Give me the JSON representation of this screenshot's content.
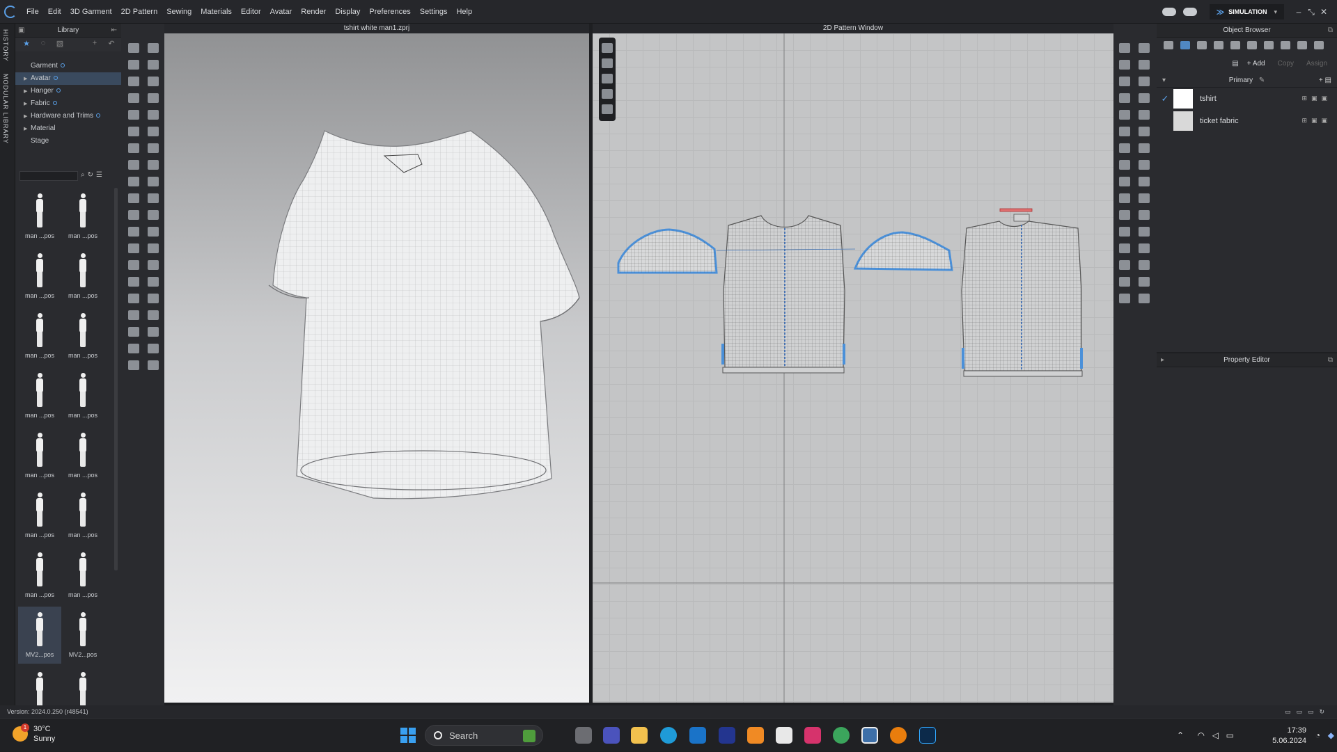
{
  "menubar": {
    "items": [
      "File",
      "Edit",
      "3D Garment",
      "2D Pattern",
      "Sewing",
      "Materials",
      "Editor",
      "Avatar",
      "Render",
      "Display",
      "Preferences",
      "Settings",
      "Help"
    ],
    "mode": "SIMULATION"
  },
  "vtabs": {
    "history": "HISTORY",
    "modular": "MODULAR LIBRARY"
  },
  "library": {
    "title": "Library",
    "tree": [
      {
        "label": "Garment",
        "arrow": ""
      },
      {
        "label": "Avatar",
        "arrow": "▶"
      },
      {
        "label": "Hanger",
        "arrow": "▶"
      },
      {
        "label": "Fabric",
        "arrow": "▶"
      },
      {
        "label": "Hardware and Trims",
        "arrow": "▶"
      },
      {
        "label": "Material",
        "arrow": "▶"
      },
      {
        "label": "Stage",
        "arrow": ""
      }
    ],
    "thumbs": [
      "man ...pos",
      "man ...pos",
      "man ...pos",
      "man ...pos",
      "man ...pos",
      "man ...pos",
      "man ...pos",
      "man ...pos",
      "man ...pos",
      "man ...pos",
      "man ...pos",
      "man ...pos",
      "man ...pos",
      "man ...pos",
      "MV2...pos",
      "MV2...pos",
      "",
      ""
    ]
  },
  "view3d": {
    "title": "tshirt white man1.zprj"
  },
  "view2d": {
    "title": "2D Pattern Window"
  },
  "object_browser": {
    "title": "Object Browser",
    "add": "Add",
    "copy": "Copy",
    "assign": "Assign",
    "section": "Primary",
    "items": [
      {
        "name": "tshirt",
        "checked": true,
        "swatch": "#ffffff"
      },
      {
        "name": "ticket fabric",
        "checked": false,
        "swatch": "#d9d9d9"
      }
    ]
  },
  "property_editor": {
    "title": "Property Editor"
  },
  "status": {
    "version": "Version: 2024.0.250 (r48541)"
  },
  "taskbar": {
    "temp": "30°C",
    "weather": "Sunny",
    "weather_badge": "1",
    "search": "Search",
    "time": "17:39",
    "date": "5.06.2024"
  }
}
